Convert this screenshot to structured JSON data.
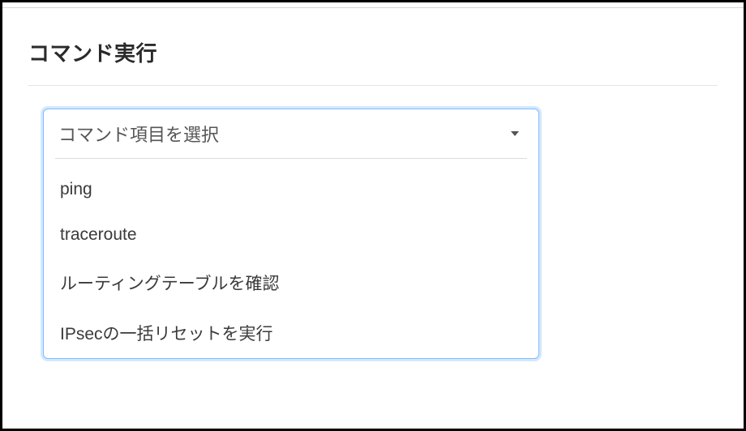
{
  "section": {
    "title": "コマンド実行"
  },
  "dropdown": {
    "placeholder": "コマンド項目を選択",
    "options": [
      {
        "label": "ping"
      },
      {
        "label": "traceroute"
      },
      {
        "label": "ルーティングテーブルを確認"
      },
      {
        "label": "IPsecの一括リセットを実行"
      }
    ]
  }
}
